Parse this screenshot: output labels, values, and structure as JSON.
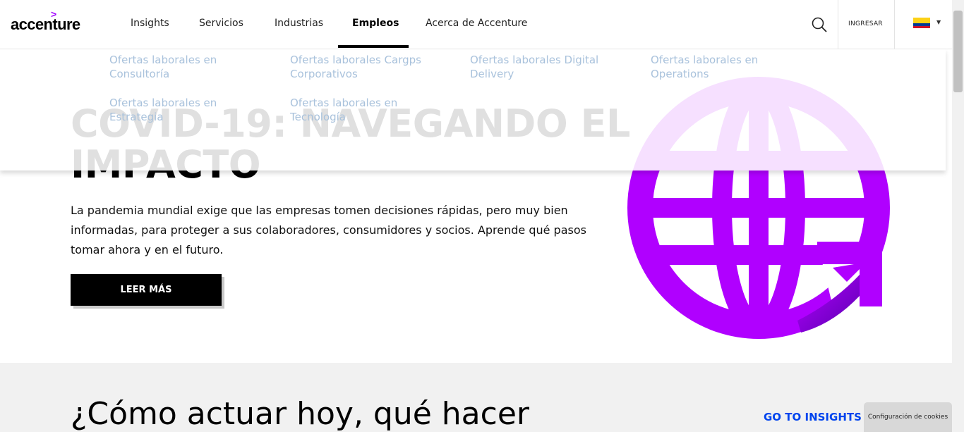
{
  "header": {
    "logo_text": "accenture",
    "logo_mark": ">",
    "nav": [
      "Insights",
      "Servicios",
      "Industrias",
      "Empleos",
      "Acerca de Accenture"
    ],
    "active_nav": "Empleos",
    "login_label": "INGRESAR",
    "search_icon": "search-icon",
    "country_flag": "colombia-flag"
  },
  "dropdown": {
    "items": [
      "Ofertas laborales en Consultoría",
      "Ofertas laborales Cargps Corporativos",
      "Ofertas laborales Digital Delivery",
      "Ofertas laborales en Operations",
      "Ofertas laborales en Estrategia",
      "Ofertas laborales en Tecnología"
    ]
  },
  "hero": {
    "title": "COVID-19: NAVEGANDO EL IMPACTO",
    "text": "La pandemia mundial exige que las empresas tomen decisiones rápidas, pero muy bien informadas, para proteger a sus colaboradores, consumidores y socios. Aprende qué pasos tomar ahora y en el futuro.",
    "button_label": "LEER MÁS",
    "image_icon": "globe-icon"
  },
  "section2": {
    "heading": "¿Cómo actuar hoy, qué hacer",
    "link_label": "GO TO INSIGHTS"
  },
  "cookie_button": "Configuración de cookies",
  "colors": {
    "accent": "#a100ff",
    "link": "#0044ee",
    "submenu_text": "#a9c2dc"
  }
}
